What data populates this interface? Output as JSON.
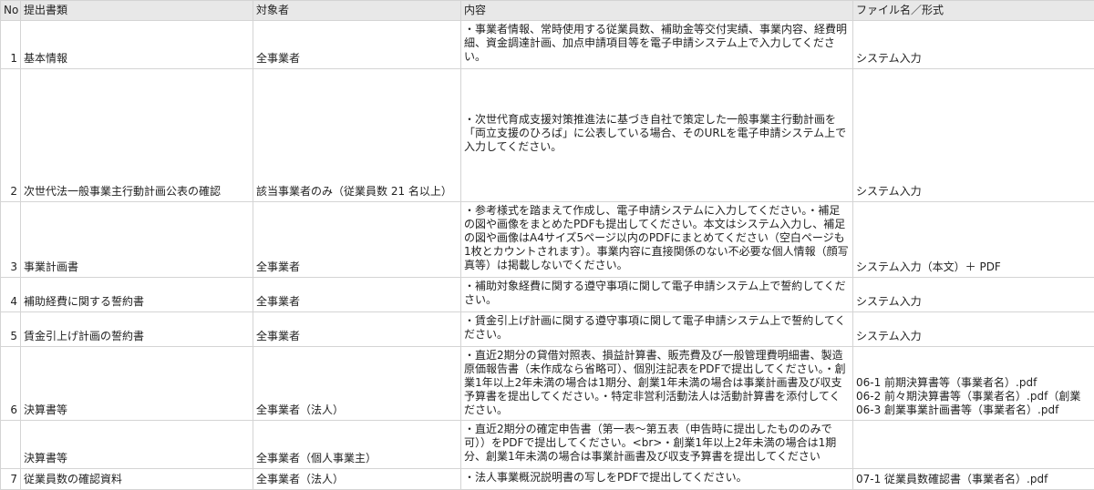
{
  "headers": {
    "no": "No",
    "document": "提出書類",
    "target": "対象者",
    "content": "内容",
    "file": "ファイル名／形式"
  },
  "rows": [
    {
      "no": "1",
      "document": "基本情報",
      "target": "全事業者",
      "content": "・事業者情報、常時使用する従業員数、補助金等交付実績、事業内容、経費明細、資金調達計画、加点申請項目等を電子申請システム上で入力してください。",
      "file": [
        "システム入力"
      ]
    },
    {
      "no": "2",
      "document": "次世代法一般事業主行動計画公表の確認",
      "target": "該当事業者のみ（従業員数 21 名以上）",
      "content": "・次世代育成支援対策推進法に基づき自社で策定した一般事業主行動計画を「両立支援のひろば」に公表している場合、そのURLを電子申請システム上で入力してください。",
      "file": [
        "システム入力"
      ]
    },
    {
      "no": "3",
      "document": "事業計画書",
      "target": "全事業者",
      "content": "・参考様式を踏まえて作成し、電子申請システムに入力してください。・補足の図や画像をまとめたPDFも提出してください。本文はシステム入力し、補足の図や画像はA4サイズ5ページ以内のPDFにまとめてください（空白ページも1枚とカウントされます）。事業内容に直接関係のない不必要な個人情報（顔写真等）は掲載しないでください。",
      "file": [
        "システム入力（本文）＋ PDF"
      ]
    },
    {
      "no": "4",
      "document": "補助経費に関する誓約書",
      "target": "全事業者",
      "content": "・補助対象経費に関する遵守事項に関して電子申請システム上で誓約してください。",
      "file": [
        "システム入力"
      ]
    },
    {
      "no": "5",
      "document": "賃金引上げ計画の誓約書",
      "target": "全事業者",
      "content": "・賃金引上げ計画に関する遵守事項に関して電子申請システム上で誓約してください。",
      "file": [
        "システム入力"
      ]
    },
    {
      "no": "6",
      "document": "決算書等",
      "target": "全事業者（法人）",
      "content": "・直近2期分の貸借対照表、損益計算書、販売費及び一般管理費明細書、製造原価報告書（未作成なら省略可）、個別注記表をPDFで提出してください。・創業1年以上2年未満の場合は1期分、創業1年未満の場合は事業計画書及び収支予算書を提出してください。・特定非営利活動法人は活動計算書を添付してください。",
      "file": [
        "06-1 前期決算書等（事業者名）.pdf",
        "06-2 前々期決算書等（事業者名）.pdf（創業",
        "06-3 創業事業計画書等（事業者名）.pdf"
      ]
    },
    {
      "no": "",
      "document": "決算書等",
      "target": "全事業者（個人事業主）",
      "content": "・直近2期分の確定申告書（第一表～第五表（申告時に提出したもののみで可））をPDFで提出してください。<br>・創業1年以上2年未満の場合は1期分、創業1年未満の場合は事業計画書及び収支予算書を提出してください",
      "file": [
        ""
      ]
    },
    {
      "no": "7",
      "document": "従業員数の確認資料",
      "target": "全事業者（法人）",
      "content": "・法人事業概況説明書の写しをPDFで提出してください。",
      "file": [
        "07-1 従業員数確認書（事業者名）.pdf"
      ]
    }
  ]
}
